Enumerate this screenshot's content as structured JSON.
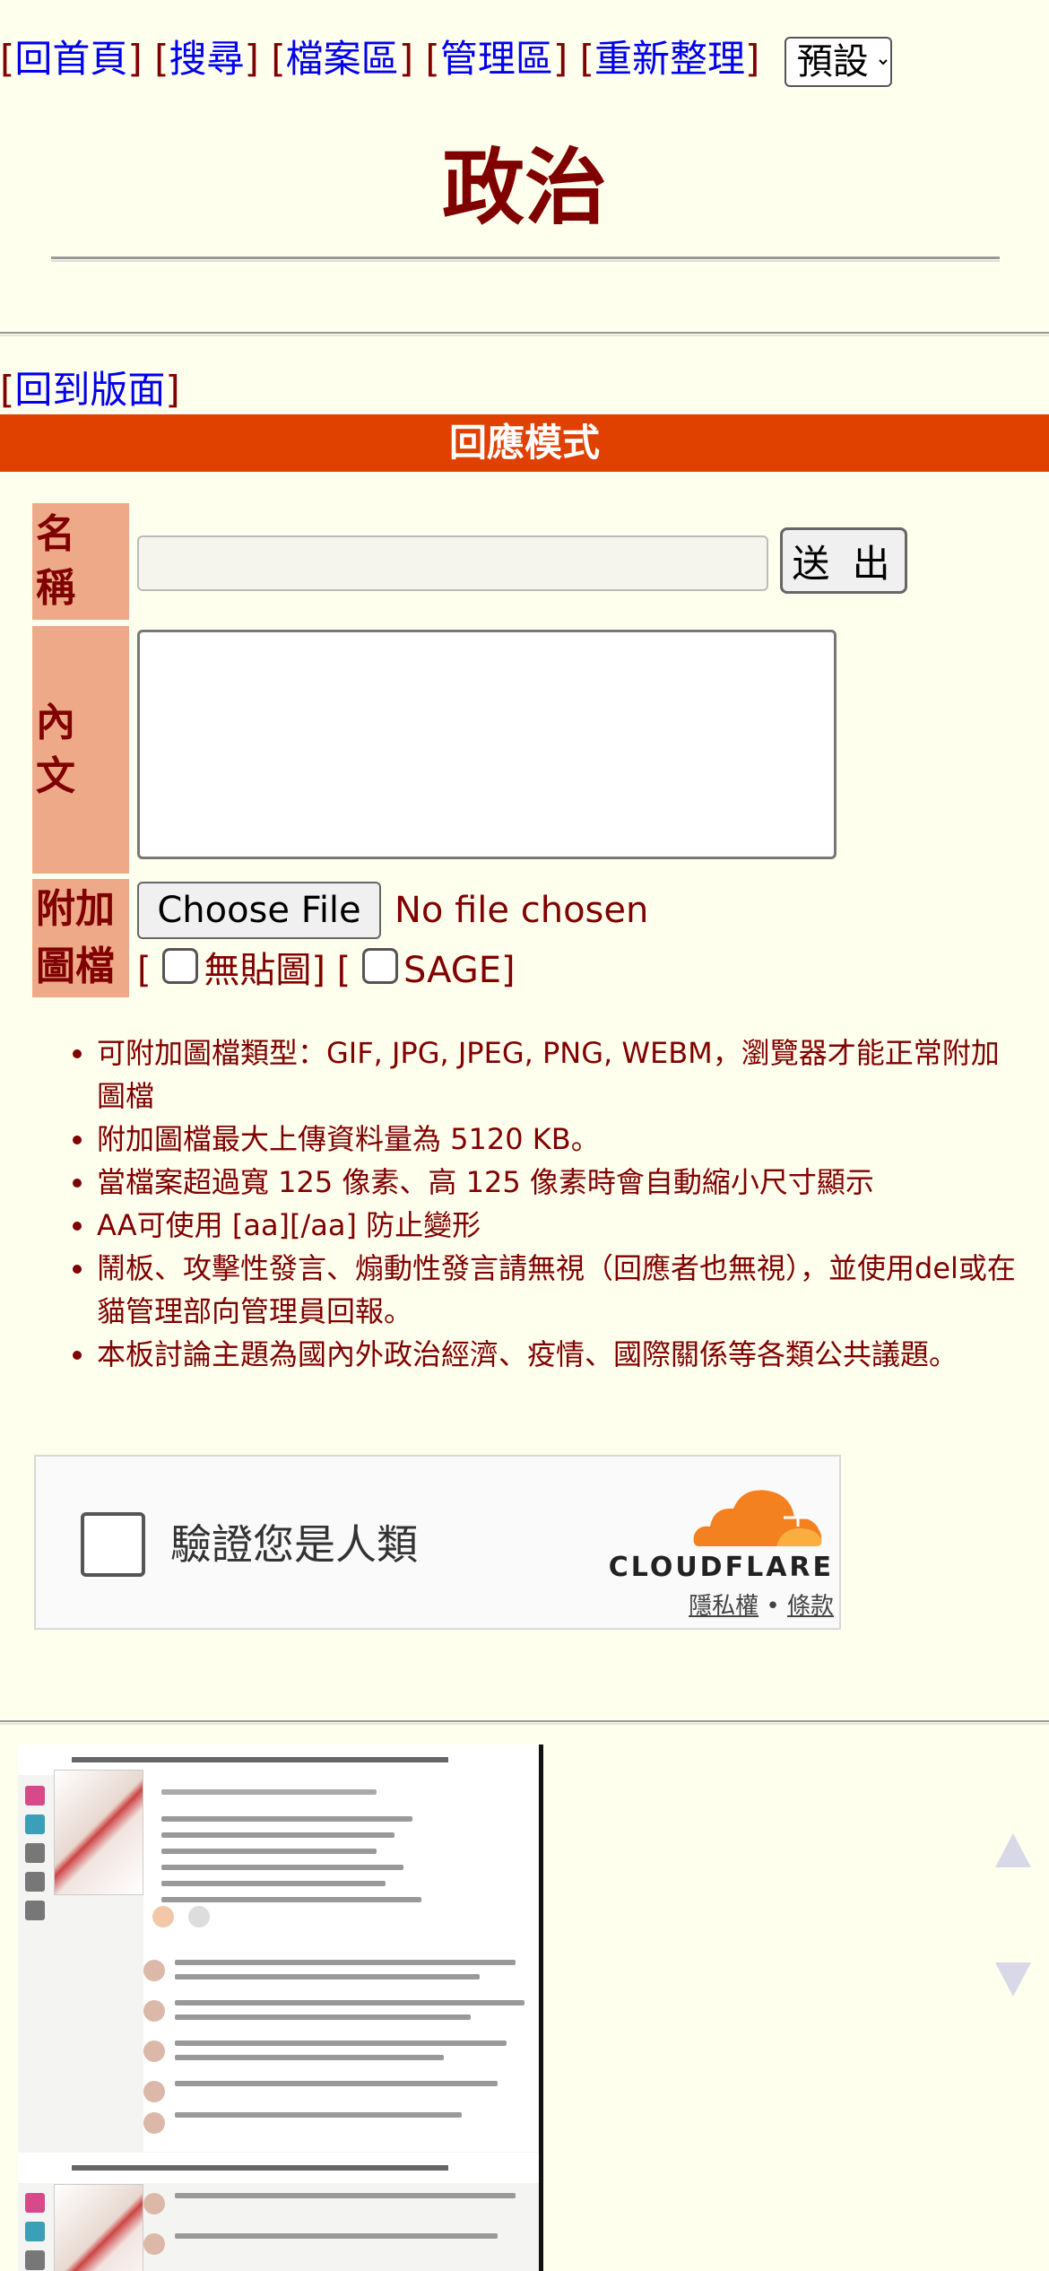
{
  "nav": {
    "home": "回首頁",
    "search": "搜尋",
    "archive": "檔案區",
    "admin": "管理區",
    "refresh": "重新整理",
    "theme_selected": "預設"
  },
  "board": {
    "title": "政治"
  },
  "back_link": "回到版面",
  "reply_mode": "回應模式",
  "form": {
    "name_label": "名稱",
    "submit_label": "送 出",
    "body_label": "內文",
    "attach_label": "附加圖檔",
    "file_button": "Choose File",
    "file_status": "No file chosen",
    "no_image_label": "無貼圖",
    "sage_label": "SAGE"
  },
  "rules": [
    "可附加圖檔類型：GIF, JPG, JPEG, PNG, WEBM，瀏覽器才能正常附加圖檔",
    "附加圖檔最大上傳資料量為 5120 KB。",
    "當檔案超過寬 125 像素、高 125 像素時會自動縮小尺寸顯示",
    "AA可使用 [aa][/aa] 防止變形",
    "鬧板、攻擊性發言、煽動性發言請無視（回應者也無視），並使用del或在貓管理部向管理員回報。",
    "本板討論主題為國內外政治經濟、疫情、國際關係等各類公共議題。"
  ],
  "captcha": {
    "label": "驗證您是人類",
    "brand": "CLOUDFLARE",
    "privacy": "隱私權",
    "separator": "•",
    "terms": "條款"
  },
  "colors": {
    "background": "#FFFFEE",
    "text": "#800000",
    "link": "#0000EE",
    "reply_bar": "#E04000",
    "label_bg": "#EEAA88",
    "cloudflare_orange": "#F48120"
  }
}
